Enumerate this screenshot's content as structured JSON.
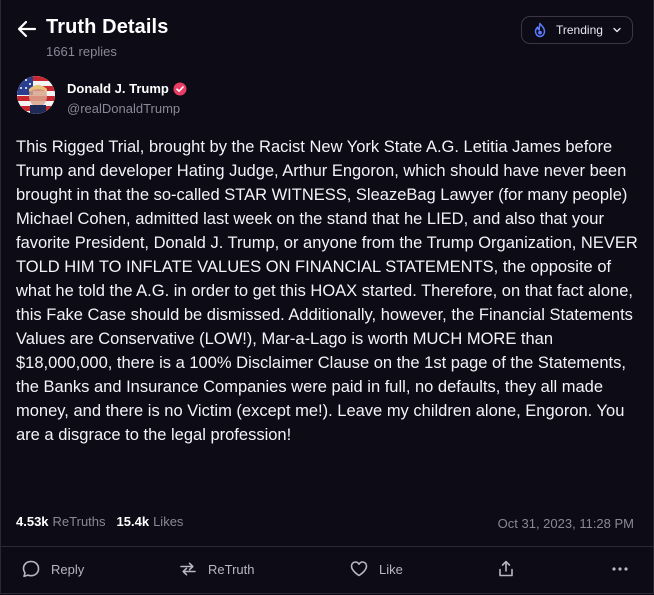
{
  "header": {
    "title": "Truth Details",
    "replies": "1661 replies",
    "trending_label": "Trending"
  },
  "author": {
    "display_name": "Donald J. Trump",
    "handle": "@realDonaldTrump"
  },
  "post": {
    "text": "This Rigged Trial, brought by the Racist New York State A.G. Letitia James before Trump and developer Hating Judge, Arthur Engoron, which should have never been brought in that the so-called STAR WITNESS, SleazeBag Lawyer (for many people) Michael Cohen, admitted last week on the stand that he LIED, and also that your favorite President, Donald J. Trump, or anyone from the Trump Organization, NEVER TOLD HIM TO INFLATE VALUES ON FINANCIAL STATEMENTS, the opposite of what he told the A.G. in order to get this HOAX started. Therefore, on that fact alone, this Fake Case should be dismissed. Additionally, however, the Financial Statements Values are Conservative (LOW!), Mar-a-Lago is worth MUCH MORE than $18,000,000, there is a 100% Disclaimer Clause on the 1st page of the Statements, the Banks and Insurance Companies were paid in full, no defaults, they all made money, and there is no Victim (except me!). Leave my children alone, Engoron. You are a disgrace to the legal profession!",
    "retruths_count": "4.53k",
    "retruths_label": "ReTruths",
    "likes_count": "15.4k",
    "likes_label": "Likes",
    "timestamp": "Oct 31, 2023, 11:28 PM"
  },
  "actions": {
    "reply": "Reply",
    "retruth": "ReTruth",
    "like": "Like"
  },
  "colors": {
    "background": "#0d0b16",
    "accent": "#5b6cff",
    "verified": "#e93d64",
    "muted_text": "#8a8896"
  }
}
